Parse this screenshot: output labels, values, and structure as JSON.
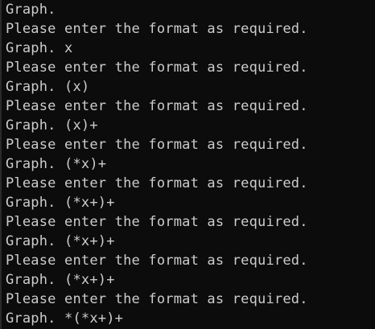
{
  "console": {
    "lines": [
      "Graph.",
      "Please enter the format as required.",
      "Graph. x",
      "Please enter the format as required.",
      "Graph. (x)",
      "Please enter the format as required.",
      "Graph. (x)+",
      "Please enter the format as required.",
      "Graph. (*x)+",
      "Please enter the format as required.",
      "Graph. (*x+)+",
      "Please enter the format as required.",
      "Graph. (*x+)+",
      "Please enter the format as required.",
      "Graph. (*x+)+",
      "Please enter the format as required.",
      "Graph. *(*x+)+"
    ]
  },
  "colors": {
    "background": "#0c0c0c",
    "text": "#cccccc"
  }
}
